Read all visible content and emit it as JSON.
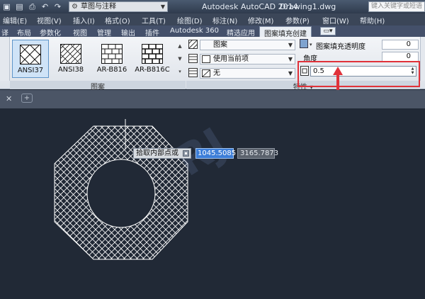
{
  "titlebar": {
    "workspace": "草图与注释",
    "app_title": "Autodesk AutoCAD 2014",
    "doc_title": "Drawing1.dwg",
    "search_placeholder": "键入关键字或短语"
  },
  "menubar": [
    "编辑(E)",
    "视图(V)",
    "插入(I)",
    "格式(O)",
    "工具(T)",
    "绘图(D)",
    "标注(N)",
    "修改(M)",
    "参数(P)",
    "窗口(W)",
    "帮助(H)"
  ],
  "tabs": [
    "译",
    "布局",
    "参数化",
    "视图",
    "管理",
    "输出",
    "插件",
    "Autodesk 360",
    "精选应用",
    "图案填充创建"
  ],
  "active_tab": "图案填充创建",
  "patterns": [
    {
      "label": "ANSI37",
      "selected": true,
      "icon": "crosshatch-pattern-icon"
    },
    {
      "label": "ANSI38",
      "selected": false,
      "icon": "dense-crosshatch-pattern-icon"
    },
    {
      "label": "AR-B816",
      "selected": false,
      "icon": "brick-pattern-icon"
    },
    {
      "label": "AR-B816C",
      "selected": false,
      "icon": "brick-pattern-icon"
    }
  ],
  "groups": {
    "pattern": "图案",
    "properties": "特性"
  },
  "properties": {
    "type": "图案",
    "color": "使用当前项",
    "background": "无",
    "transparency_label": "图案填充透明度",
    "transparency_value": "0",
    "angle_label": "角度",
    "angle_value": "0",
    "scale_value": "0.5"
  },
  "canvas": {
    "prompt_label": "拾取内部点或",
    "coord_x": "1045.5085",
    "coord_y": "3165.7873"
  },
  "colors": {
    "accent_highlight": "#e0323a",
    "canvas_bg": "#212936",
    "coord_active": "#3d7ed8"
  }
}
